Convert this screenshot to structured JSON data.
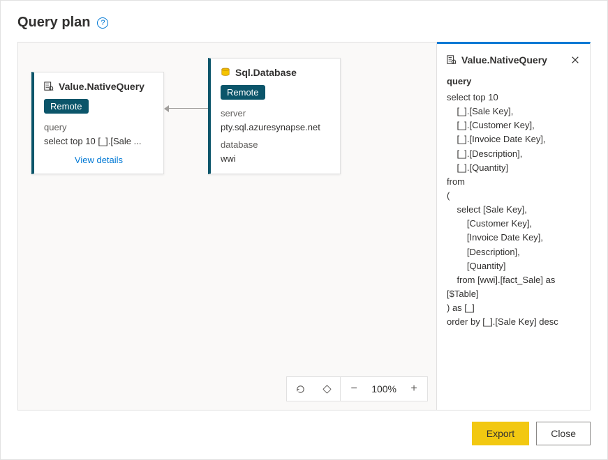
{
  "dialog": {
    "title": "Query plan",
    "help_icon": "?"
  },
  "canvas": {
    "nodes": [
      {
        "title": "Value.NativeQuery",
        "badge": "Remote",
        "fields": {
          "query_label": "query",
          "query_value": "select top 10 [_].[Sale ..."
        },
        "view_details": "View details"
      },
      {
        "title": "Sql.Database",
        "badge": "Remote",
        "fields": {
          "server_label": "server",
          "server_value": "pty.sql.azuresynapse.net",
          "database_label": "database",
          "database_value": "wwi"
        }
      }
    ],
    "zoom": {
      "reset_icon": "reset",
      "fit_icon": "fit",
      "minus": "−",
      "percent": "100%",
      "plus": "+"
    }
  },
  "detail": {
    "title": "Value.NativeQuery",
    "close": "✕",
    "section_label": "query",
    "query_text": "select top 10\n    [_].[Sale Key],\n    [_].[Customer Key],\n    [_].[Invoice Date Key],\n    [_].[Description],\n    [_].[Quantity]\nfrom\n(\n    select [Sale Key],\n        [Customer Key],\n        [Invoice Date Key],\n        [Description],\n        [Quantity]\n    from [wwi].[fact_Sale] as [$Table]\n) as [_]\norder by [_].[Sale Key] desc"
  },
  "footer": {
    "export": "Export",
    "close": "Close"
  }
}
